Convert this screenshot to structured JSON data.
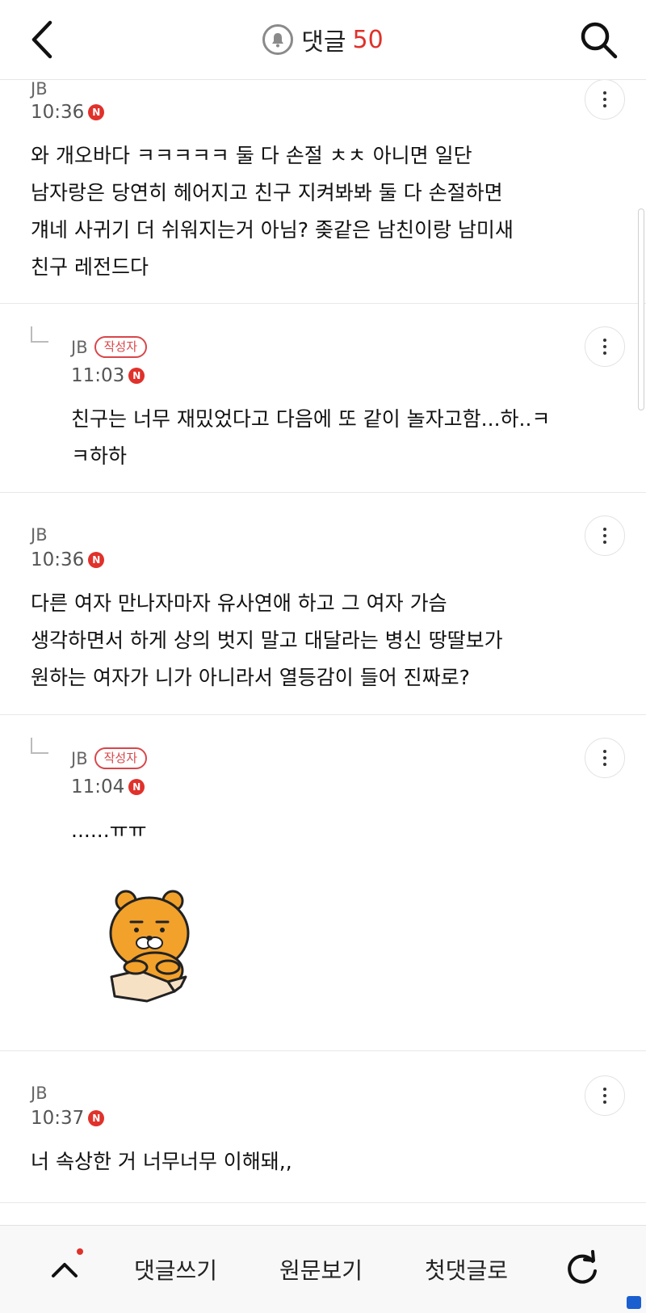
{
  "header": {
    "title": "댓글",
    "count": "50",
    "back_icon": "chevron-left-icon",
    "bell_icon": "bell-icon",
    "search_icon": "search-icon"
  },
  "comments": [
    {
      "author": "JB",
      "time": "10:36",
      "new_badge": "N",
      "text": "와 개오바다 ㅋㅋㅋㅋㅋ 둘 다 손절 ㅊㅊ 아니면 일단\n남자랑은 당연히 헤어지고 친구 지켜봐봐 둘 다 손절하면\n걔네 사귀기 더 쉬워지는거 아님? 좆같은 남친이랑 남미새\n친구 레전드다"
    },
    {
      "author": "JB",
      "writer_badge": "작성자",
      "time": "11:03",
      "new_badge": "N",
      "text": "친구는 너무 재밌었다고 다음에 또 같이 놀자고함...하..ㅋ\nㅋ하하"
    },
    {
      "author": "JB",
      "time": "10:36",
      "new_badge": "N",
      "text": "다른 여자 만나자마자 유사연애 하고 그 여자 가슴\n생각하면서 하게 상의 벗지 말고 대달라는 병신 땅딸보가\n원하는 여자가 니가 아니라서 열등감이 들어 진짜로?"
    },
    {
      "author": "JB",
      "writer_badge": "작성자",
      "time": "11:04",
      "new_badge": "N",
      "text": "......ㅠㅠ",
      "sticker": "ryan-bear-in-box-sticker"
    },
    {
      "author": "JB",
      "time": "10:37",
      "new_badge": "N",
      "text": "너 속상한 거 너무너무 이해돼,,"
    }
  ],
  "bottom_bar": {
    "write": "댓글쓰기",
    "original": "원문보기",
    "first": "첫댓글로",
    "up_icon": "chevron-up-icon",
    "refresh_icon": "refresh-icon"
  },
  "colors": {
    "accent": "#e0312b",
    "writer_badge": "#d8464a",
    "sticker": "#f2a12b"
  }
}
